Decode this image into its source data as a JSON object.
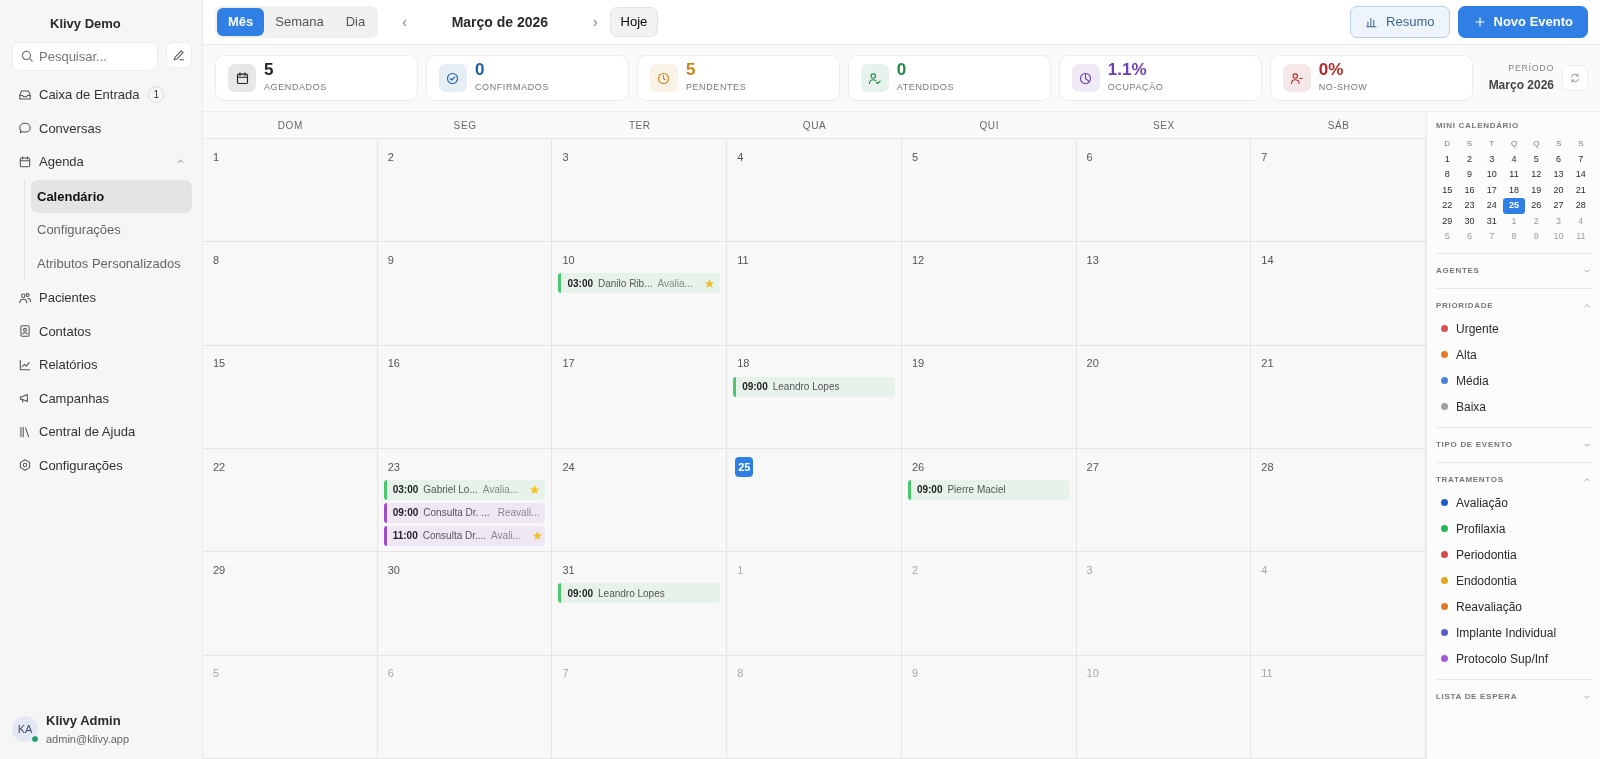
{
  "sidebar": {
    "brand": "Klivy Demo",
    "search": {
      "placeholder": "Pesquisar..."
    },
    "nav": [
      {
        "label": "Caixa de Entrada",
        "badge": "1"
      },
      {
        "label": "Conversas"
      },
      {
        "label": "Agenda",
        "expanded": true,
        "children": [
          {
            "label": "Calendário",
            "selected": true
          },
          {
            "label": "Configurações",
            "selected": false
          },
          {
            "label": "Atributos Personalizados",
            "selected": false
          }
        ]
      },
      {
        "label": "Pacientes"
      },
      {
        "label": "Contatos"
      },
      {
        "label": "Relatórios"
      },
      {
        "label": "Campanhas"
      },
      {
        "label": "Central de Ajuda"
      },
      {
        "label": "Configurações"
      }
    ],
    "user": {
      "initials": "KA",
      "name": "Klivy Admin",
      "email": "admin@klivy.app",
      "online": true
    }
  },
  "toolbar": {
    "views": [
      {
        "label": "Mês",
        "selected": true
      },
      {
        "label": "Semana",
        "selected": false
      },
      {
        "label": "Dia",
        "selected": false
      }
    ],
    "prev": "‹",
    "title": "Março de 2026",
    "next": "›",
    "today": "Hoje",
    "actions": [
      {
        "label": "Resumo",
        "kind": "secondary"
      },
      {
        "label": "Novo Evento",
        "kind": "primary"
      }
    ]
  },
  "stats": [
    {
      "value": "5",
      "label": "AGENDADOS",
      "color": "#222222"
    },
    {
      "value": "0",
      "label": "CONFIRMADOS",
      "color": "#1f5fa8"
    },
    {
      "value": "5",
      "label": "PENDENTES",
      "color": "#c7851a"
    },
    {
      "value": "0",
      "label": "ATENDIDOS",
      "color": "#1f8a4c"
    },
    {
      "value": "1.1%",
      "label": "OCUPAÇÃO",
      "color": "#6b3fb0"
    },
    {
      "value": "0%",
      "label": "NO-SHOW",
      "color": "#b02a2a"
    }
  ],
  "period": {
    "label": "PERÍODO",
    "value": "Março 2026"
  },
  "calendar": {
    "weekdays": [
      "DOM",
      "SEG",
      "TER",
      "QUA",
      "QUI",
      "SEX",
      "SÁB"
    ],
    "weeks": [
      [
        {
          "day": "1"
        },
        {
          "day": "2"
        },
        {
          "day": "3"
        },
        {
          "day": "4"
        },
        {
          "day": "5"
        },
        {
          "day": "6"
        },
        {
          "day": "7"
        }
      ],
      [
        {
          "day": "8"
        },
        {
          "day": "9"
        },
        {
          "day": "10",
          "events": [
            {
              "time": "03:00",
              "title": "Danilo Rib...",
              "type": "Avalia...",
              "color": "#4cc96f",
              "starred": true
            }
          ]
        },
        {
          "day": "11"
        },
        {
          "day": "12"
        },
        {
          "day": "13"
        },
        {
          "day": "14"
        }
      ],
      [
        {
          "day": "15"
        },
        {
          "day": "16"
        },
        {
          "day": "17"
        },
        {
          "day": "18",
          "events": [
            {
              "time": "09:00",
              "title": "Leandro Lopes",
              "color": "#4cc96f",
              "starred": false
            }
          ]
        },
        {
          "day": "19"
        },
        {
          "day": "20"
        },
        {
          "day": "21"
        }
      ],
      [
        {
          "day": "22"
        },
        {
          "day": "23",
          "events": [
            {
              "time": "03:00",
              "title": "Gabriel Lo...",
              "type": "Avalia...",
              "color": "#4cc96f",
              "starred": true
            },
            {
              "time": "09:00",
              "title": "Consulta Dr. ...",
              "type": "Reavali...",
              "color": "#9b4dca",
              "starred": false
            },
            {
              "time": "11:00",
              "title": "Consulta Dr....",
              "type": "Avali...",
              "color": "#9b4dca",
              "starred": true
            }
          ]
        },
        {
          "day": "24"
        },
        {
          "day": "25",
          "today": true
        },
        {
          "day": "26",
          "events": [
            {
              "time": "09:00",
              "title": "Pierre Maciel",
              "color": "#4cc96f",
              "starred": false
            }
          ]
        },
        {
          "day": "27"
        },
        {
          "day": "28"
        }
      ],
      [
        {
          "day": "29"
        },
        {
          "day": "30"
        },
        {
          "day": "31",
          "events": [
            {
              "time": "09:00",
              "title": "Leandro Lopes",
              "color": "#4cc96f",
              "starred": false
            }
          ]
        },
        {
          "day": "1",
          "outside": true
        },
        {
          "day": "2",
          "outside": true
        },
        {
          "day": "3",
          "outside": true
        },
        {
          "day": "4",
          "outside": true
        }
      ],
      [
        {
          "day": "5",
          "outside": true
        },
        {
          "day": "6",
          "outside": true
        },
        {
          "day": "7",
          "outside": true
        },
        {
          "day": "8",
          "outside": true
        },
        {
          "day": "9",
          "outside": true
        },
        {
          "day": "10",
          "outside": true
        },
        {
          "day": "11",
          "outside": true
        }
      ]
    ]
  },
  "right_panel": {
    "mini_calendar": {
      "title": "MINI CALENDÁRIO",
      "weekdays": [
        "D",
        "S",
        "T",
        "Q",
        "Q",
        "S",
        "S"
      ],
      "weeks": [
        [
          {
            "day": "1"
          },
          {
            "day": "2"
          },
          {
            "day": "3"
          },
          {
            "day": "4"
          },
          {
            "day": "5"
          },
          {
            "day": "6"
          },
          {
            "day": "7"
          }
        ],
        [
          {
            "day": "8"
          },
          {
            "day": "9"
          },
          {
            "day": "10"
          },
          {
            "day": "11"
          },
          {
            "day": "12"
          },
          {
            "day": "13"
          },
          {
            "day": "14"
          }
        ],
        [
          {
            "day": "15"
          },
          {
            "day": "16"
          },
          {
            "day": "17"
          },
          {
            "day": "18"
          },
          {
            "day": "19"
          },
          {
            "day": "20"
          },
          {
            "day": "21"
          }
        ],
        [
          {
            "day": "22"
          },
          {
            "day": "23"
          },
          {
            "day": "24"
          },
          {
            "day": "25",
            "selected": true
          },
          {
            "day": "26"
          },
          {
            "day": "27"
          },
          {
            "day": "28"
          }
        ],
        [
          {
            "day": "29"
          },
          {
            "day": "30"
          },
          {
            "day": "31"
          },
          {
            "day": "1",
            "outside": true
          },
          {
            "day": "2",
            "outside": true
          },
          {
            "day": "3",
            "outside": true
          },
          {
            "day": "4",
            "outside": true
          }
        ],
        [
          {
            "day": "5",
            "outside": true
          },
          {
            "day": "6",
            "outside": true
          },
          {
            "day": "7",
            "outside": true
          },
          {
            "day": "8",
            "outside": true
          },
          {
            "day": "9",
            "outside": true
          },
          {
            "day": "10",
            "outside": true
          },
          {
            "day": "11",
            "outside": true
          }
        ]
      ]
    },
    "sections": [
      {
        "title": "AGENTES",
        "expanded": false
      },
      {
        "title": "PRIORIDADE",
        "expanded": true,
        "items": [
          {
            "label": "Urgente",
            "color": "#d9534f"
          },
          {
            "label": "Alta",
            "color": "#e07b2a"
          },
          {
            "label": "Média",
            "color": "#4a7fd6"
          },
          {
            "label": "Baixa",
            "color": "#9e9e9e"
          }
        ]
      },
      {
        "title": "TIPO DE EVENTO",
        "expanded": false
      },
      {
        "title": "TRATAMENTOS",
        "expanded": true,
        "items": [
          {
            "label": "Avaliação",
            "color": "#1f5fbf"
          },
          {
            "label": "Profilaxia",
            "color": "#2bb55a"
          },
          {
            "label": "Periodontia",
            "color": "#d24b4b"
          },
          {
            "label": "Endodontia",
            "color": "#e5a91f"
          },
          {
            "label": "Reavaliação",
            "color": "#e07b2a"
          },
          {
            "label": "Implante Individual",
            "color": "#5b5fc7"
          },
          {
            "label": "Protocolo Sup/Inf",
            "color": "#a15ad6"
          }
        ]
      },
      {
        "title": "LISTA DE ESPERA",
        "expanded": false
      }
    ]
  }
}
